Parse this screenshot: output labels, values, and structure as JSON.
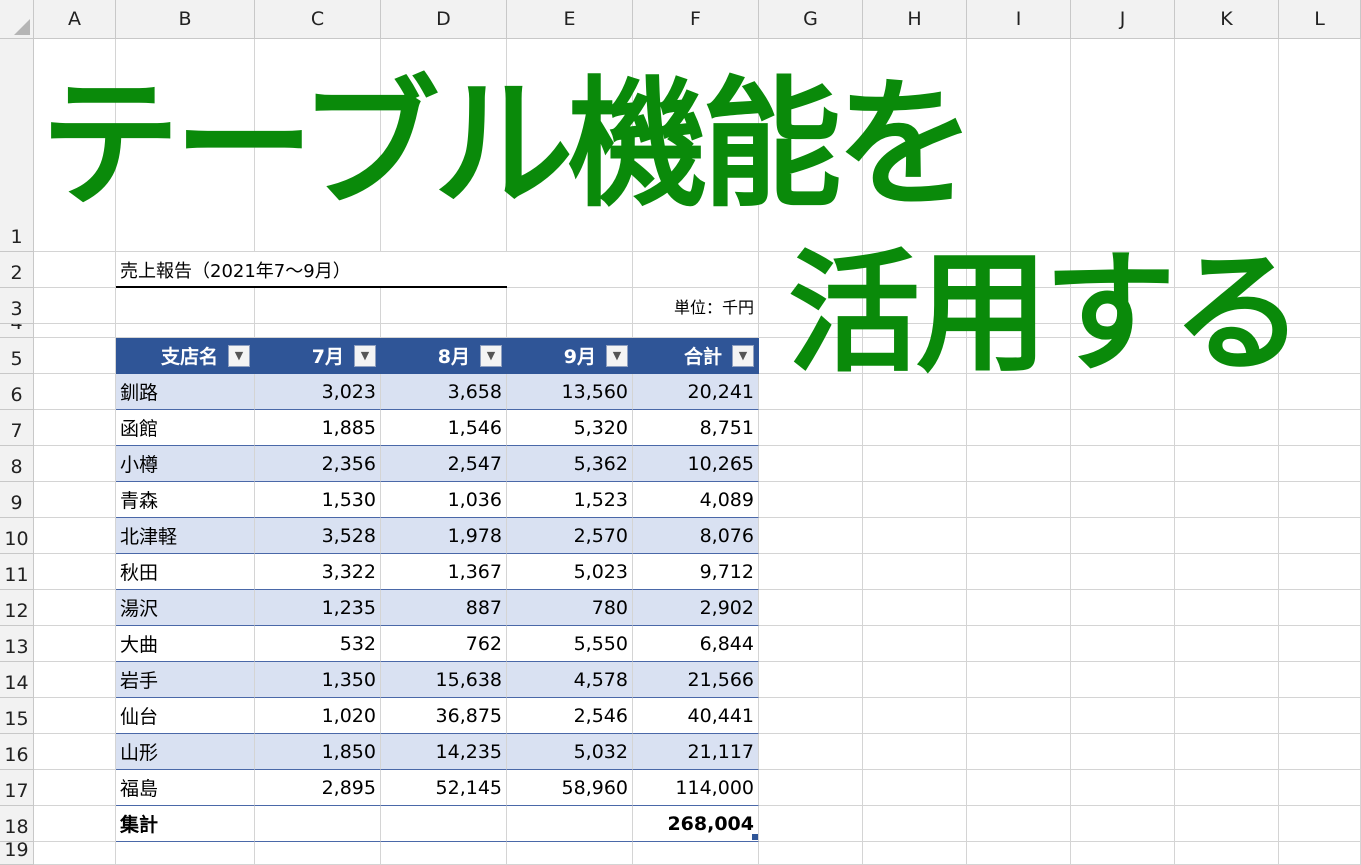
{
  "columns": [
    "A",
    "B",
    "C",
    "D",
    "E",
    "F",
    "G",
    "H",
    "I",
    "J",
    "K",
    "L"
  ],
  "rows": [
    "1",
    "2",
    "3",
    "4",
    "5",
    "6",
    "7",
    "8",
    "9",
    "10",
    "11",
    "12",
    "13",
    "14",
    "15",
    "16",
    "17",
    "18",
    "19"
  ],
  "report_title": "売上報告（2021年7〜9月）",
  "unit_label": "単位：千円",
  "overlay": {
    "line1": "テーブル機能を",
    "line2": "活用する"
  },
  "table": {
    "headers": [
      "支店名",
      "7月",
      "8月",
      "9月",
      "合計"
    ],
    "filter_icon": "dropdown-arrow-icon",
    "rows": [
      [
        "釧路",
        "3,023",
        "3,658",
        "13,560",
        "20,241"
      ],
      [
        "函館",
        "1,885",
        "1,546",
        "5,320",
        "8,751"
      ],
      [
        "小樽",
        "2,356",
        "2,547",
        "5,362",
        "10,265"
      ],
      [
        "青森",
        "1,530",
        "1,036",
        "1,523",
        "4,089"
      ],
      [
        "北津軽",
        "3,528",
        "1,978",
        "2,570",
        "8,076"
      ],
      [
        "秋田",
        "3,322",
        "1,367",
        "5,023",
        "9,712"
      ],
      [
        "湯沢",
        "1,235",
        "887",
        "780",
        "2,902"
      ],
      [
        "大曲",
        "532",
        "762",
        "5,550",
        "6,844"
      ],
      [
        "岩手",
        "1,350",
        "15,638",
        "4,578",
        "21,566"
      ],
      [
        "仙台",
        "1,020",
        "36,875",
        "2,546",
        "40,441"
      ],
      [
        "山形",
        "1,850",
        "14,235",
        "5,032",
        "21,117"
      ],
      [
        "福島",
        "2,895",
        "52,145",
        "58,960",
        "114,000"
      ]
    ],
    "total_label": "集計",
    "total_value": "268,004"
  },
  "colors": {
    "header_fill": "#2f5597",
    "band_fill": "#d9e1f2",
    "overlay_text": "#0a8a0a"
  }
}
